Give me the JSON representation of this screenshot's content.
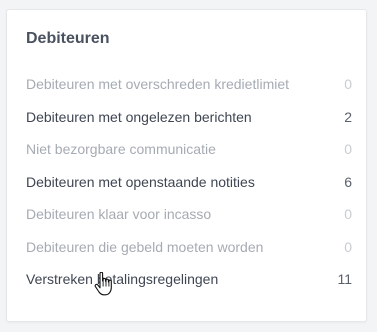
{
  "panel": {
    "title": "Debiteuren",
    "items": [
      {
        "label": "Debiteuren met overschreden kredietlimiet",
        "count": "0",
        "state": "muted"
      },
      {
        "label": "Debiteuren met ongelezen berichten",
        "count": "2",
        "state": "active"
      },
      {
        "label": "Niet bezorgbare communicatie",
        "count": "0",
        "state": "muted"
      },
      {
        "label": "Debiteuren met openstaande notities",
        "count": "6",
        "state": "active"
      },
      {
        "label": "Debiteuren klaar voor incasso",
        "count": "0",
        "state": "muted"
      },
      {
        "label": "Debiteuren die gebeld moeten worden",
        "count": "0",
        "state": "muted"
      },
      {
        "label": "Verstreken betalingsregelingen",
        "count": "11",
        "state": "active"
      }
    ]
  },
  "cursor": {
    "icon": "hand-pointer-icon"
  },
  "colors": {
    "title": "#4a5260",
    "active_text": "#3f4652",
    "muted_text": "#a6abb3",
    "card_background": "#ffffff",
    "page_background": "#f3f4f6"
  }
}
